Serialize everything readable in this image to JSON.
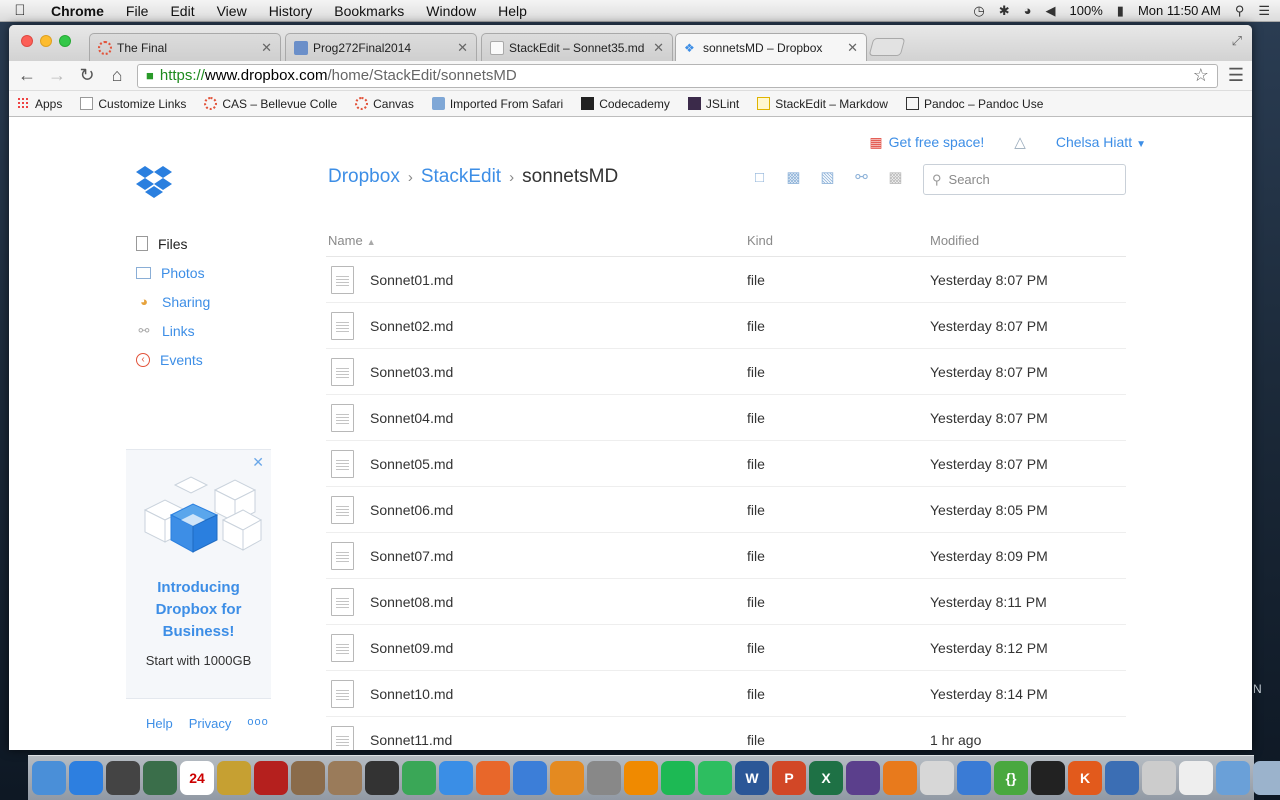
{
  "menubar": {
    "app": "Chrome",
    "items": [
      "File",
      "Edit",
      "View",
      "History",
      "Bookmarks",
      "Window",
      "Help"
    ],
    "battery": "100%",
    "clock": "Mon 11:50 AM"
  },
  "browser": {
    "tabs": [
      {
        "title": "The Final",
        "favicon_color": "#e2533a"
      },
      {
        "title": "Prog272Final2014",
        "favicon_color": "#6b8fc9"
      },
      {
        "title": "StackEdit – Sonnet35.md",
        "favicon_color": "#dddddd"
      },
      {
        "title": "sonnetsMD – Dropbox",
        "favicon_color": "#3d8ee6"
      }
    ],
    "url": {
      "scheme": "https://",
      "host": "www.dropbox.com",
      "path": "/home/StackEdit/sonnetsMD"
    },
    "bookmarks": [
      {
        "label": "Apps",
        "icon": "apps-grid-icon"
      },
      {
        "label": "Customize Links",
        "icon": "page-icon"
      },
      {
        "label": "CAS – Bellevue Colle",
        "icon": "cas-icon"
      },
      {
        "label": "Canvas",
        "icon": "canvas-icon"
      },
      {
        "label": "Imported From Safari",
        "icon": "folder-icon"
      },
      {
        "label": "Codecademy",
        "icon": "codecademy-icon"
      },
      {
        "label": "JSLint",
        "icon": "jslint-icon"
      },
      {
        "label": "StackEdit – Markdow",
        "icon": "stackedit-icon"
      },
      {
        "label": "Pandoc – Pandoc Use",
        "icon": "pandoc-icon"
      }
    ]
  },
  "dropbox": {
    "topbar": {
      "free_space": "Get free space!",
      "user": "Chelsa Hiatt"
    },
    "sidebar": [
      {
        "label": "Files",
        "icon": "files-icon"
      },
      {
        "label": "Photos",
        "icon": "photos-icon"
      },
      {
        "label": "Sharing",
        "icon": "sharing-icon"
      },
      {
        "label": "Links",
        "icon": "links-icon"
      },
      {
        "label": "Events",
        "icon": "events-icon"
      }
    ],
    "promo": {
      "title": "Introducing Dropbox for Business!",
      "subtitle": "Start with 1000GB"
    },
    "footer": {
      "help": "Help",
      "privacy": "Privacy",
      "more": "ooo"
    },
    "breadcrumb": {
      "root": "Dropbox",
      "parent": "StackEdit",
      "current": "sonnetsMD"
    },
    "search_placeholder": "Search",
    "columns": {
      "name": "Name",
      "kind": "Kind",
      "modified": "Modified"
    },
    "files": [
      {
        "name": "Sonnet01.md",
        "kind": "file",
        "modified": "Yesterday 8:07 PM"
      },
      {
        "name": "Sonnet02.md",
        "kind": "file",
        "modified": "Yesterday 8:07 PM"
      },
      {
        "name": "Sonnet03.md",
        "kind": "file",
        "modified": "Yesterday 8:07 PM"
      },
      {
        "name": "Sonnet04.md",
        "kind": "file",
        "modified": "Yesterday 8:07 PM"
      },
      {
        "name": "Sonnet05.md",
        "kind": "file",
        "modified": "Yesterday 8:07 PM"
      },
      {
        "name": "Sonnet06.md",
        "kind": "file",
        "modified": "Yesterday 8:05 PM"
      },
      {
        "name": "Sonnet07.md",
        "kind": "file",
        "modified": "Yesterday 8:09 PM"
      },
      {
        "name": "Sonnet08.md",
        "kind": "file",
        "modified": "Yesterday 8:11 PM"
      },
      {
        "name": "Sonnet09.md",
        "kind": "file",
        "modified": "Yesterday 8:12 PM"
      },
      {
        "name": "Sonnet10.md",
        "kind": "file",
        "modified": "Yesterday 8:14 PM"
      },
      {
        "name": "Sonnet11.md",
        "kind": "file",
        "modified": "1 hr ago"
      }
    ],
    "accent_color": "#3d8ee6"
  },
  "dock": [
    {
      "name": "finder-icon",
      "color": "#4a8fd8"
    },
    {
      "name": "app-store-icon",
      "color": "#2d7fe0"
    },
    {
      "name": "dashboard-icon",
      "color": "#444444"
    },
    {
      "name": "time-machine-icon",
      "color": "#3a6e4a"
    },
    {
      "name": "calendar-icon",
      "color": "#ffffff",
      "text": "24"
    },
    {
      "name": "imovie-icon",
      "color": "#c6a032"
    },
    {
      "name": "photo-booth-icon",
      "color": "#b5201e"
    },
    {
      "name": "preview-icon",
      "color": "#8a6b4a"
    },
    {
      "name": "iphoto-icon",
      "color": "#9a7b5a"
    },
    {
      "name": "aperture-icon",
      "color": "#333333"
    },
    {
      "name": "chrome-icon",
      "color": "#3aa757"
    },
    {
      "name": "safari-icon",
      "color": "#3a8ee6"
    },
    {
      "name": "firefox-icon",
      "color": "#e8672a"
    },
    {
      "name": "itunes-icon",
      "color": "#3c7ed8"
    },
    {
      "name": "ibooks-icon",
      "color": "#e48a20"
    },
    {
      "name": "script-editor-icon",
      "color": "#888888"
    },
    {
      "name": "vlc-icon",
      "color": "#f08a00"
    },
    {
      "name": "spotify-icon",
      "color": "#1db954"
    },
    {
      "name": "evernote-icon",
      "color": "#2dbe60"
    },
    {
      "name": "word-icon",
      "color": "#2b5797",
      "text": "W"
    },
    {
      "name": "powerpoint-icon",
      "color": "#d24726",
      "text": "P"
    },
    {
      "name": "excel-icon",
      "color": "#1e7145",
      "text": "X"
    },
    {
      "name": "eclipse-icon",
      "color": "#5b3f8c"
    },
    {
      "name": "system-preferences-icon",
      "color": "#e87a1c"
    },
    {
      "name": "textedit-icon",
      "color": "#d7d7d7"
    },
    {
      "name": "xcode-icon",
      "color": "#3a7bd5"
    },
    {
      "name": "brackets-icon",
      "color": "#49a83f",
      "text": "{}"
    },
    {
      "name": "terminal-icon",
      "color": "#222222"
    },
    {
      "name": "komodo-icon",
      "color": "#e25a1c",
      "text": "K"
    },
    {
      "name": "virtualbox-icon",
      "color": "#3b6eb4"
    },
    {
      "name": "settings-gear-icon",
      "color": "#cccccc"
    },
    {
      "name": "document-icon",
      "color": "#eeeeee"
    },
    {
      "name": "folder-stack-icon",
      "color": "#6aa0d8"
    },
    {
      "name": "downloads-stack-icon",
      "color": "#9bb3cc"
    },
    {
      "name": "trash-icon",
      "color": "#c8c8c8"
    }
  ]
}
